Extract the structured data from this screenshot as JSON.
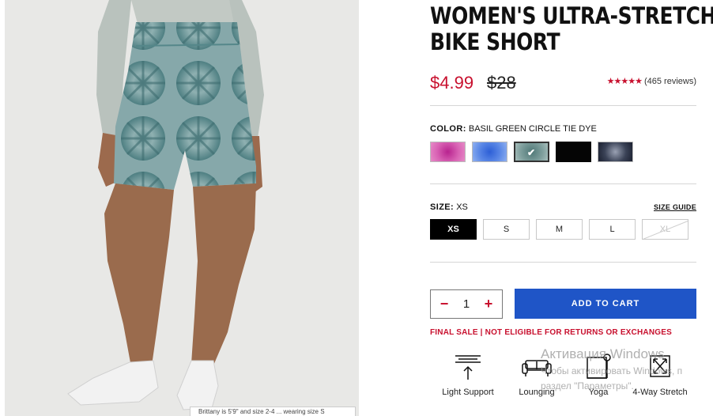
{
  "product": {
    "title_line1": "WOMEN'S ULTRA-STRETCH",
    "title_line2": "BIKE SHORT",
    "sale_price": "$4.99",
    "original_price": "$28",
    "rating_stars": "★★★★★",
    "reviews": "(465 reviews)"
  },
  "photo": {
    "caption": "Brittany is 5'9\" and size 2-4 ... wearing size S"
  },
  "color": {
    "label": "COLOR:",
    "selected": "BASIL GREEN CIRCLE TIE DYE",
    "swatches": [
      {
        "name": "magenta",
        "color": "#c4389c",
        "selected": false
      },
      {
        "name": "blue",
        "color": "#3f73e0",
        "selected": false
      },
      {
        "name": "basil green circle tie dye",
        "color": "#6f8e8c",
        "selected": true
      },
      {
        "name": "black",
        "color": "#050505",
        "selected": false
      },
      {
        "name": "navy",
        "color": "#3a4256",
        "selected": false
      }
    ]
  },
  "size": {
    "label": "SIZE:",
    "selected": "XS",
    "guide": "SIZE GUIDE",
    "options": [
      {
        "label": "XS",
        "state": "selected"
      },
      {
        "label": "S",
        "state": "available"
      },
      {
        "label": "M",
        "state": "available"
      },
      {
        "label": "L",
        "state": "available"
      },
      {
        "label": "XL",
        "state": "unavailable"
      }
    ]
  },
  "cart": {
    "minus": "−",
    "quantity": "1",
    "plus": "+",
    "add_label": "ADD TO CART",
    "final_sale": "FINAL SALE | NOT ELIGIBLE FOR RETURNS OR EXCHANGES"
  },
  "features": [
    {
      "label": "Light Support",
      "icon": "light-support-icon"
    },
    {
      "label": "Lounging",
      "icon": "sofa-icon"
    },
    {
      "label": "Yoga",
      "icon": "yoga-mat-icon"
    },
    {
      "label": "4-Way Stretch",
      "icon": "four-way-stretch-icon"
    }
  ],
  "watermark": {
    "title": "Активация Windows",
    "line1": "Чтобы активировать Windows, п",
    "line2": "раздел \"Параметры\"."
  },
  "colors": {
    "accent_red": "#c8102e",
    "cart_blue": "#1f55c7"
  }
}
